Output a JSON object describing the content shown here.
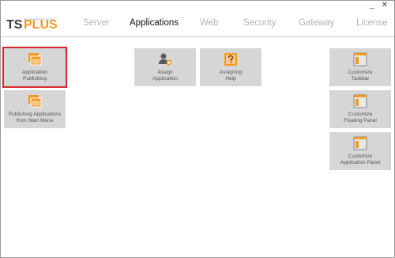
{
  "window": {
    "controls": "_ ✕"
  },
  "logo": {
    "brand_ts": "TS",
    "brand_plus": "PLUS",
    "tagline": "SECURE REMOTE ACCESS"
  },
  "nav": {
    "tabs": [
      {
        "label": "Server",
        "active": false
      },
      {
        "label": "Applications",
        "active": true
      },
      {
        "label": "Web",
        "active": false
      },
      {
        "label": "Security",
        "active": false
      },
      {
        "label": "Gateway",
        "active": false
      },
      {
        "label": "License",
        "active": false
      }
    ]
  },
  "tiles": {
    "app_publishing": {
      "label": "Application\nPublishing",
      "icon": "windows-stack-icon",
      "selected": true
    },
    "publish_start_menu": {
      "label": "Publishing Applications\nfrom Start Menu",
      "icon": "windows-stack-icon"
    },
    "assign_application": {
      "label": "Assign\nApplication",
      "icon": "user-add-icon"
    },
    "assigning_help": {
      "label": "Assigning\nHelp",
      "icon": "help-question-icon"
    },
    "customize_taskbar": {
      "label": "Customize\nTaskbar",
      "icon": "window-panel-icon"
    },
    "customize_floating_panel": {
      "label": "Customize\nFloating Panel",
      "icon": "window-panel-icon"
    },
    "customize_app_panel": {
      "label": "Customize\nApplication Panel",
      "icon": "window-panel-icon"
    }
  },
  "colors": {
    "accent_orange": "#f29a22",
    "selection_red": "#d9252a",
    "tile_bg": "#d6d6d6"
  }
}
